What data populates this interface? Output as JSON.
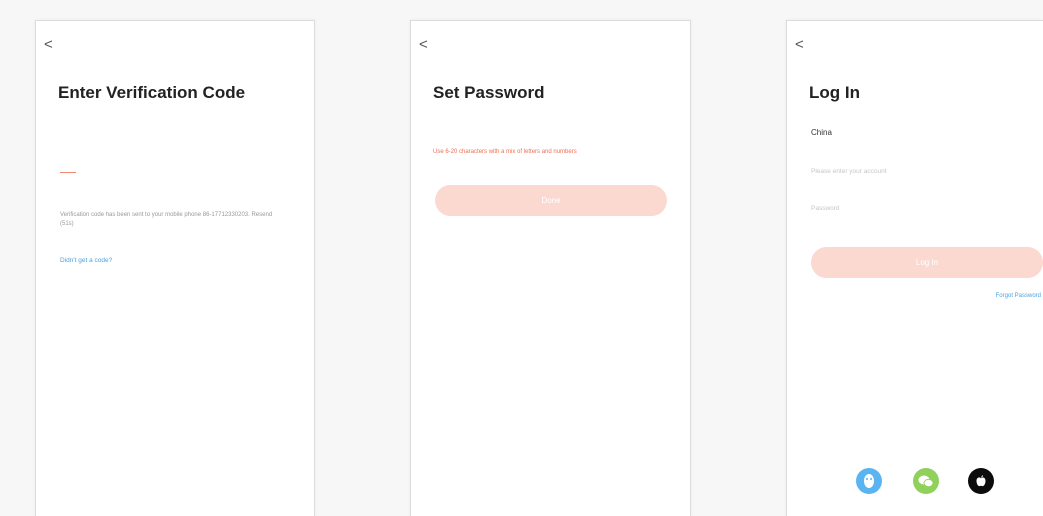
{
  "screens": {
    "verification": {
      "back": "<",
      "title": "Enter Verification Code",
      "sent_text": "Verification code has been sent to your mobile phone 86-17712330203. Resend (51s)",
      "resend_link": "Didn't get a code?"
    },
    "set_password": {
      "back": "<",
      "title": "Set Password",
      "hint": "Use 6-20 characters with a mix of letters and numbers",
      "done_label": "Done"
    },
    "login": {
      "back": "<",
      "title": "Log In",
      "region": "China",
      "account_placeholder": "Please enter your account",
      "password_placeholder": "Password",
      "login_label": "Log In",
      "forgot_label": "Forgot Password",
      "social_icons": [
        "qq-icon",
        "wechat-icon",
        "apple-icon"
      ]
    }
  },
  "colors": {
    "accent": "#ef6f55",
    "button_disabled": "#fbd9d1",
    "link": "#4aa3e0",
    "qq": "#5ab4f2",
    "wechat": "#8fd15a",
    "apple": "#0c0c0c"
  }
}
